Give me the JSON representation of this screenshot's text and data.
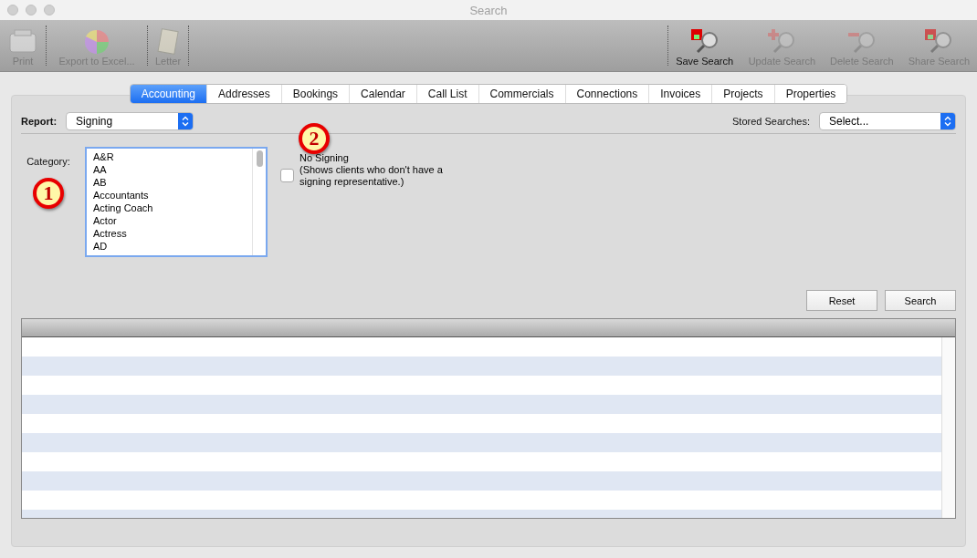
{
  "window": {
    "title": "Search"
  },
  "toolbar": {
    "left": [
      {
        "label": "Print",
        "kind": "printer",
        "disabled": true
      },
      {
        "label": "Export to Excel...",
        "kind": "pie",
        "disabled": true
      },
      {
        "label": "Letter",
        "kind": "letter",
        "disabled": true
      }
    ],
    "right": [
      {
        "label": "Save Search",
        "kind": "save",
        "disabled": false
      },
      {
        "label": "Update Search",
        "kind": "plus",
        "disabled": true
      },
      {
        "label": "Delete Search",
        "kind": "minus",
        "disabled": true
      },
      {
        "label": "Share Search",
        "kind": "save",
        "disabled": true
      }
    ]
  },
  "tabs": [
    {
      "label": "Accounting",
      "selected": true
    },
    {
      "label": "Addresses",
      "selected": false
    },
    {
      "label": "Bookings",
      "selected": false
    },
    {
      "label": "Calendar",
      "selected": false
    },
    {
      "label": "Call List",
      "selected": false
    },
    {
      "label": "Commercials",
      "selected": false
    },
    {
      "label": "Connections",
      "selected": false
    },
    {
      "label": "Invoices",
      "selected": false
    },
    {
      "label": "Projects",
      "selected": false
    },
    {
      "label": "Properties",
      "selected": false
    }
  ],
  "report": {
    "label": "Report:",
    "value": "Signing"
  },
  "stored_searches": {
    "label": "Stored Searches:",
    "value": "Select..."
  },
  "category": {
    "label": "Category:",
    "callout": "1",
    "items": [
      "A&R",
      "AA",
      "AB",
      "Accountants",
      "Acting Coach",
      "Actor",
      "Actress",
      "AD"
    ]
  },
  "no_signing": {
    "callout": "2",
    "label": "No Signing",
    "description": "(Shows clients who don't have a signing representative.)",
    "checked": false
  },
  "buttons": [
    "Reset",
    "Search"
  ]
}
